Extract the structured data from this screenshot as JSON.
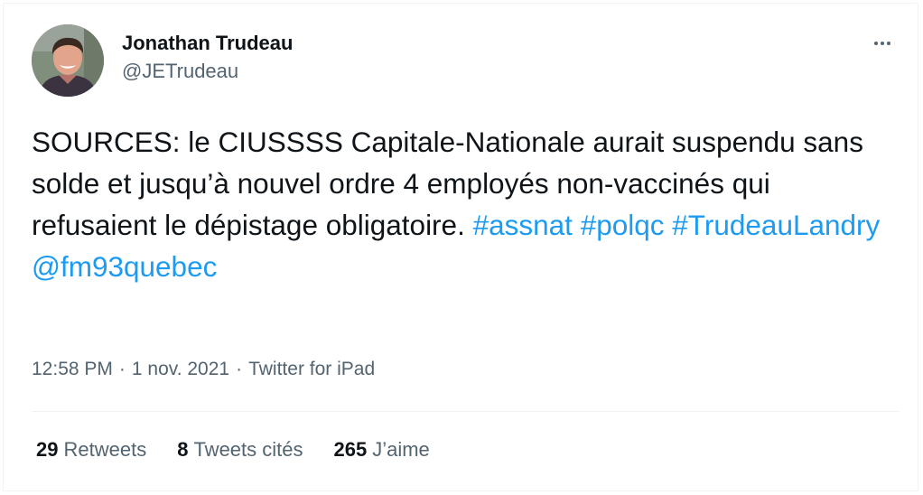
{
  "author": {
    "display_name": "Jonathan Trudeau",
    "handle": "@JETrudeau",
    "avatar_icon": "user-avatar-photo"
  },
  "more_icon": "ellipsis-icon",
  "tweet": {
    "text_part1": "SOURCES: le CIUSSSS Capitale-Nationale aurait suspendu sans solde et jusqu’à nouvel ordre 4 employés non-vaccinés qui refusaient le dépistage obligatoire.",
    "hashtags": [
      "#assnat",
      "#polqc",
      "#TrudeauLandry"
    ],
    "mention": "@fm93quebec"
  },
  "meta": {
    "time": "12:58 PM",
    "separator": "·",
    "date": "1 nov. 2021",
    "source": "Twitter for iPad"
  },
  "stats": [
    {
      "count": "29",
      "label": "Retweets"
    },
    {
      "count": "8",
      "label": "Tweets cités"
    },
    {
      "count": "265",
      "label": "J’aime"
    }
  ],
  "colors": {
    "link": "#1d9bf0",
    "primary_text": "#0f1419",
    "secondary_text": "#536471",
    "divider": "#eff3f4"
  }
}
